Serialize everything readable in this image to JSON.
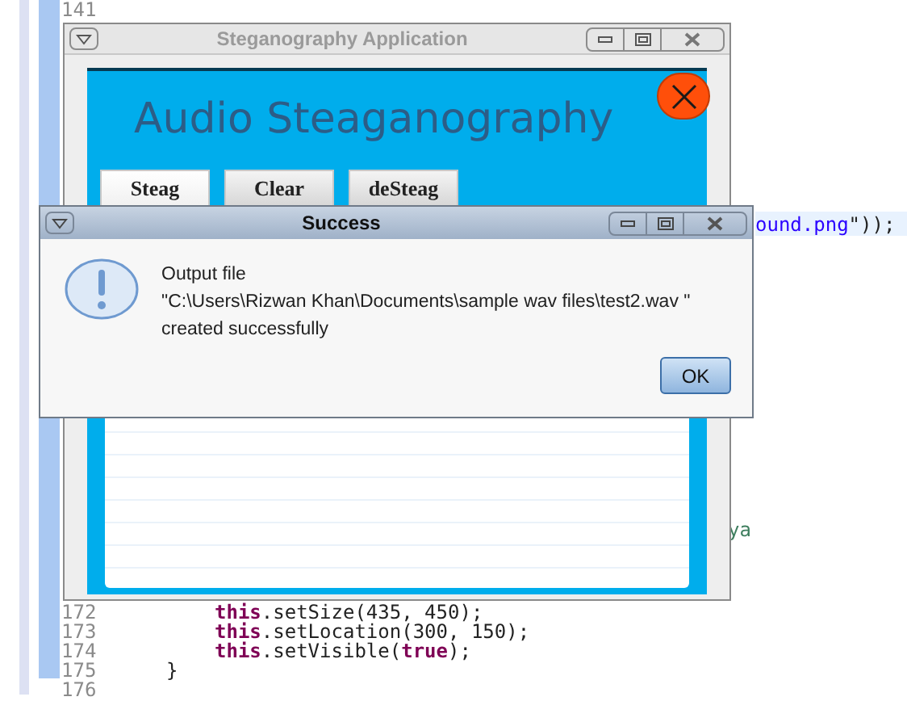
{
  "editor": {
    "top_line": {
      "number": "141"
    },
    "fragments": [
      {
        "current_line": true,
        "segments": [
          {
            "kind": "string",
            "text": "ound.png"
          },
          {
            "kind": "plain",
            "text": "\"));"
          }
        ]
      },
      {
        "current_line": false,
        "segments": [
          {
            "kind": "comment",
            "text": "ya"
          }
        ]
      }
    ],
    "lines": [
      {
        "number": "172",
        "kind": "statement",
        "segments": [
          {
            "kind": "keyword",
            "text": "this"
          },
          {
            "kind": "plain",
            "text": ".setSize(435, 450);"
          }
        ]
      },
      {
        "number": "173",
        "kind": "statement",
        "segments": [
          {
            "kind": "keyword",
            "text": "this"
          },
          {
            "kind": "plain",
            "text": ".setLocation(300, 150);"
          }
        ]
      },
      {
        "number": "174",
        "kind": "statement",
        "segments": [
          {
            "kind": "keyword",
            "text": "this"
          },
          {
            "kind": "plain",
            "text": ".setVisible("
          },
          {
            "kind": "keyword",
            "text": "true"
          },
          {
            "kind": "plain",
            "text": ");"
          }
        ]
      },
      {
        "number": "175",
        "kind": "brace",
        "segments": [
          {
            "kind": "plain",
            "text": "}"
          }
        ]
      },
      {
        "number": "176",
        "kind": "blank"
      }
    ]
  },
  "app_window": {
    "title": "Steganography Application",
    "active": false,
    "heading": "Audio Steaganography",
    "buttons": [
      {
        "label": "Steag",
        "focused": true
      },
      {
        "label": "Clear",
        "focused": false
      },
      {
        "label": "deSteag",
        "focused": false
      }
    ]
  },
  "dialog": {
    "title": "Success",
    "active": true,
    "message": [
      "Output file",
      "\"C:\\Users\\Rizwan Khan\\Documents\\sample wav files\\test2.wav \"",
      "created successfully"
    ],
    "ok_button": "OK"
  }
}
